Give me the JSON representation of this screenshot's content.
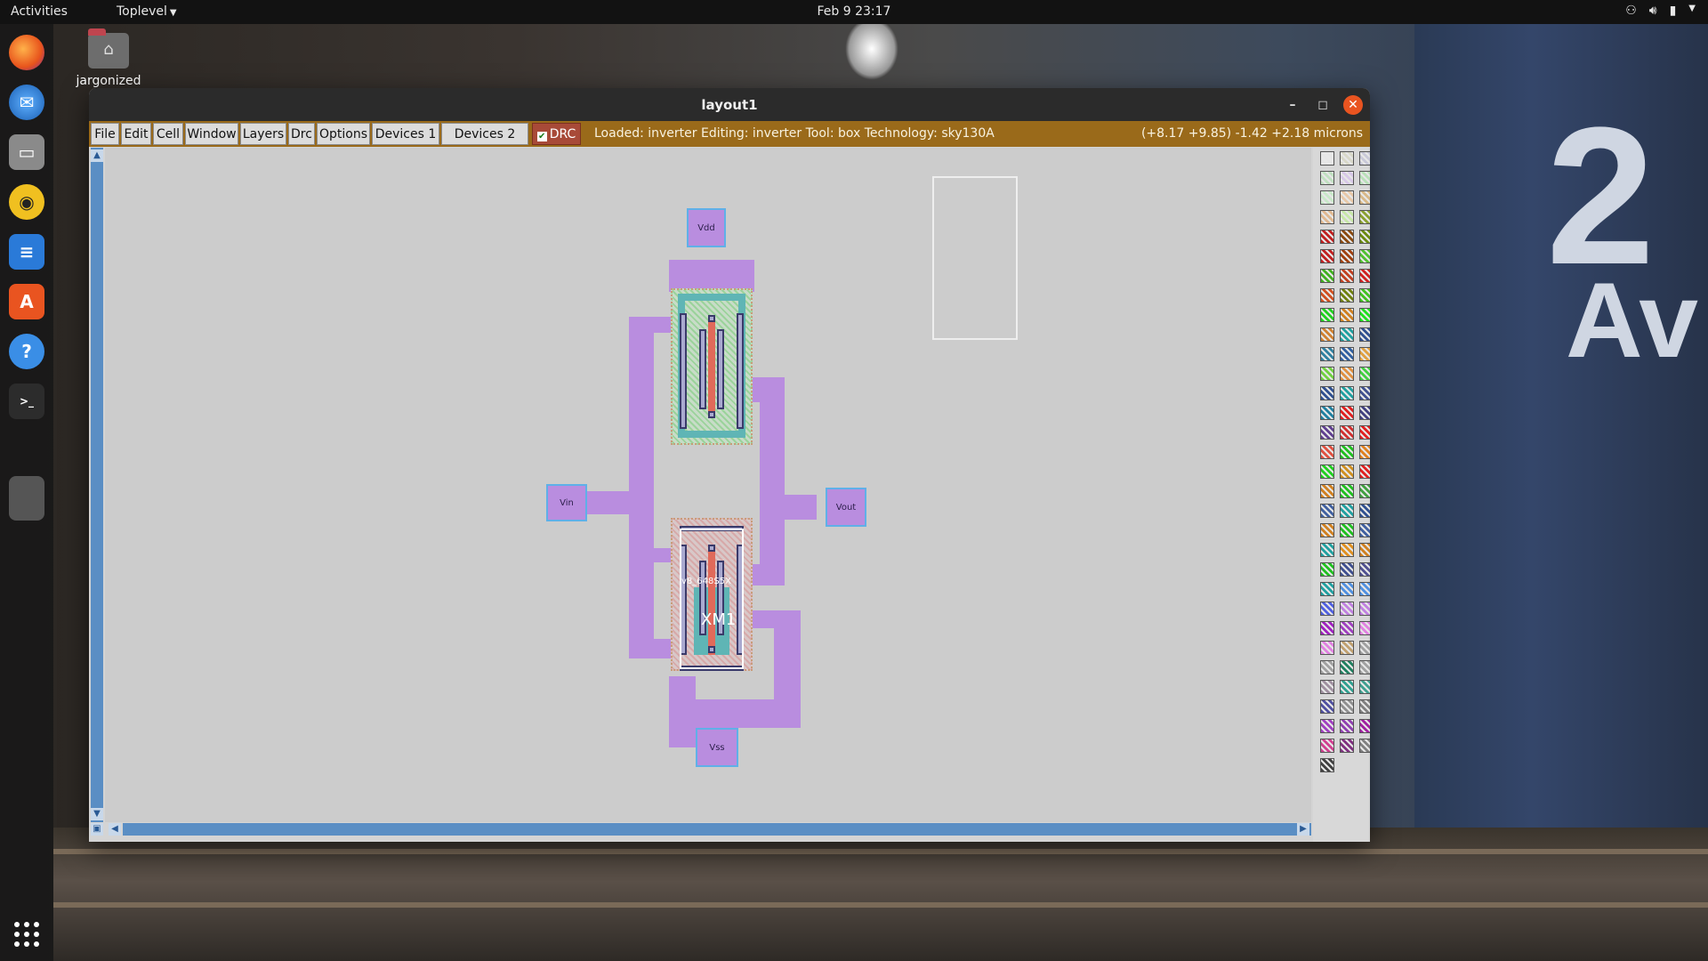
{
  "topbar": {
    "activities": "Activities",
    "app_menu": "Toplevel",
    "clock": "Feb 9  23:17",
    "tray_icons": [
      "network-icon",
      "volume-icon",
      "battery-icon",
      "system-menu-icon"
    ]
  },
  "desktop": {
    "home_folder_label": "jargonized"
  },
  "dock": {
    "items": [
      "firefox-icon",
      "thunderbird-icon",
      "files-icon",
      "rhythmbox-icon",
      "writer-icon",
      "software-icon",
      "help-icon",
      "terminal-icon",
      "window-icon"
    ]
  },
  "window": {
    "title": "layout1",
    "menus": [
      "File",
      "Edit",
      "Cell",
      "Window",
      "Layers",
      "Drc",
      "Options",
      "Devices 1",
      "Devices 2"
    ],
    "drc_label": "DRC",
    "drc_checked": true,
    "status": "Loaded: inverter Editing: inverter Tool: box  Technology: sky130A",
    "coords": "(+8.17 +9.85) -1.42 +2.18 microns"
  },
  "layout": {
    "pins": {
      "vdd": "Vdd",
      "vin": "Vin",
      "vout": "Vout",
      "vss": "Vss"
    },
    "device_label": "XM1",
    "device_sublabel": "v8_648S5X"
  },
  "colors": {
    "menubar_bg": "#9a6a1a",
    "metal": "#b98ddf",
    "pin_border": "#5fb0e8",
    "scrollbar": "#5a8ec4"
  }
}
